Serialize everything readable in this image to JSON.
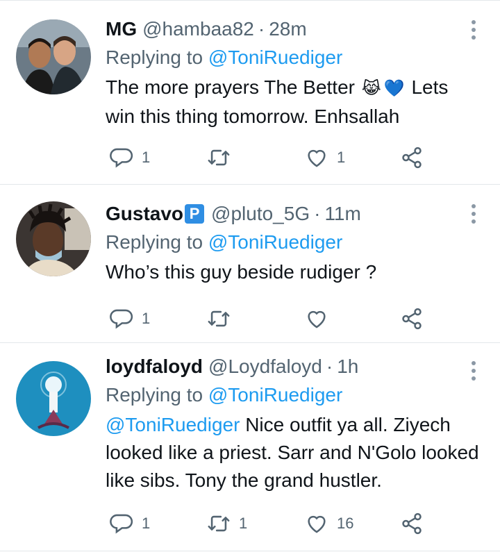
{
  "replying_prefix": "Replying to",
  "tweets": [
    {
      "name": "MG",
      "verified_icon": "",
      "handle": "@hambaa82",
      "time": "28m",
      "replying_to": "@ToniRuediger",
      "text_mention": "",
      "text_before_emoji": "The more prayers The Better",
      "emojis": [
        "face-with-tears-of-joy",
        "blue-heart"
      ],
      "text_after_emoji": "Lets win this thing tomorrow. Enhsallah",
      "counts": {
        "replies": "1",
        "retweets": "",
        "likes": "1"
      }
    },
    {
      "name": "Gustavo",
      "verified_icon": "P",
      "handle": "@pluto_5G",
      "time": "11m",
      "replying_to": "@ToniRuediger",
      "text": "Who’s this guy beside rudiger ?",
      "counts": {
        "replies": "1",
        "retweets": "",
        "likes": ""
      }
    },
    {
      "name": "loydfaloyd",
      "handle": "@Loydfaloyd",
      "time": "1h",
      "replying_to": "@ToniRuediger",
      "text_mention": "@ToniRuediger",
      "text": "Nice outfit ya all. Ziyech looked like a priest. Sarr and N'Golo looked like sibs. Tony the grand hustler.",
      "counts": {
        "replies": "1",
        "retweets": "1",
        "likes": "16"
      }
    }
  ],
  "colors": {
    "mention": "#1d9bf0",
    "muted": "#536471",
    "divider": "#e3e7ea"
  }
}
